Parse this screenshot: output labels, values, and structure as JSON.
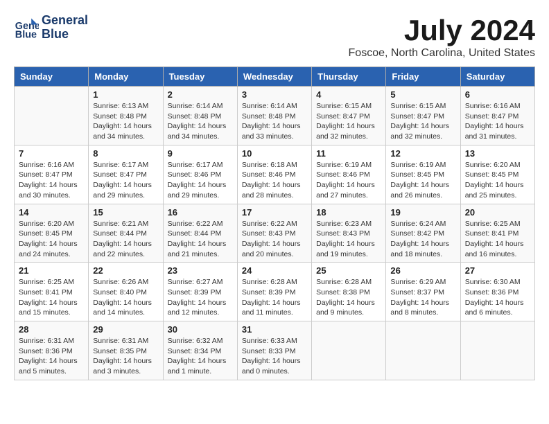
{
  "header": {
    "logo_line1": "General",
    "logo_line2": "Blue",
    "month": "July 2024",
    "location": "Foscoe, North Carolina, United States"
  },
  "days_of_week": [
    "Sunday",
    "Monday",
    "Tuesday",
    "Wednesday",
    "Thursday",
    "Friday",
    "Saturday"
  ],
  "weeks": [
    [
      {
        "num": "",
        "rise": "",
        "set": "",
        "daylight": ""
      },
      {
        "num": "1",
        "rise": "6:13 AM",
        "set": "8:48 PM",
        "daylight": "14 hours and 34 minutes."
      },
      {
        "num": "2",
        "rise": "6:14 AM",
        "set": "8:48 PM",
        "daylight": "14 hours and 34 minutes."
      },
      {
        "num": "3",
        "rise": "6:14 AM",
        "set": "8:48 PM",
        "daylight": "14 hours and 33 minutes."
      },
      {
        "num": "4",
        "rise": "6:15 AM",
        "set": "8:47 PM",
        "daylight": "14 hours and 32 minutes."
      },
      {
        "num": "5",
        "rise": "6:15 AM",
        "set": "8:47 PM",
        "daylight": "14 hours and 32 minutes."
      },
      {
        "num": "6",
        "rise": "6:16 AM",
        "set": "8:47 PM",
        "daylight": "14 hours and 31 minutes."
      }
    ],
    [
      {
        "num": "7",
        "rise": "6:16 AM",
        "set": "8:47 PM",
        "daylight": "14 hours and 30 minutes."
      },
      {
        "num": "8",
        "rise": "6:17 AM",
        "set": "8:47 PM",
        "daylight": "14 hours and 29 minutes."
      },
      {
        "num": "9",
        "rise": "6:17 AM",
        "set": "8:46 PM",
        "daylight": "14 hours and 29 minutes."
      },
      {
        "num": "10",
        "rise": "6:18 AM",
        "set": "8:46 PM",
        "daylight": "14 hours and 28 minutes."
      },
      {
        "num": "11",
        "rise": "6:19 AM",
        "set": "8:46 PM",
        "daylight": "14 hours and 27 minutes."
      },
      {
        "num": "12",
        "rise": "6:19 AM",
        "set": "8:45 PM",
        "daylight": "14 hours and 26 minutes."
      },
      {
        "num": "13",
        "rise": "6:20 AM",
        "set": "8:45 PM",
        "daylight": "14 hours and 25 minutes."
      }
    ],
    [
      {
        "num": "14",
        "rise": "6:20 AM",
        "set": "8:45 PM",
        "daylight": "14 hours and 24 minutes."
      },
      {
        "num": "15",
        "rise": "6:21 AM",
        "set": "8:44 PM",
        "daylight": "14 hours and 22 minutes."
      },
      {
        "num": "16",
        "rise": "6:22 AM",
        "set": "8:44 PM",
        "daylight": "14 hours and 21 minutes."
      },
      {
        "num": "17",
        "rise": "6:22 AM",
        "set": "8:43 PM",
        "daylight": "14 hours and 20 minutes."
      },
      {
        "num": "18",
        "rise": "6:23 AM",
        "set": "8:43 PM",
        "daylight": "14 hours and 19 minutes."
      },
      {
        "num": "19",
        "rise": "6:24 AM",
        "set": "8:42 PM",
        "daylight": "14 hours and 18 minutes."
      },
      {
        "num": "20",
        "rise": "6:25 AM",
        "set": "8:41 PM",
        "daylight": "14 hours and 16 minutes."
      }
    ],
    [
      {
        "num": "21",
        "rise": "6:25 AM",
        "set": "8:41 PM",
        "daylight": "14 hours and 15 minutes."
      },
      {
        "num": "22",
        "rise": "6:26 AM",
        "set": "8:40 PM",
        "daylight": "14 hours and 14 minutes."
      },
      {
        "num": "23",
        "rise": "6:27 AM",
        "set": "8:39 PM",
        "daylight": "14 hours and 12 minutes."
      },
      {
        "num": "24",
        "rise": "6:28 AM",
        "set": "8:39 PM",
        "daylight": "14 hours and 11 minutes."
      },
      {
        "num": "25",
        "rise": "6:28 AM",
        "set": "8:38 PM",
        "daylight": "14 hours and 9 minutes."
      },
      {
        "num": "26",
        "rise": "6:29 AM",
        "set": "8:37 PM",
        "daylight": "14 hours and 8 minutes."
      },
      {
        "num": "27",
        "rise": "6:30 AM",
        "set": "8:36 PM",
        "daylight": "14 hours and 6 minutes."
      }
    ],
    [
      {
        "num": "28",
        "rise": "6:31 AM",
        "set": "8:36 PM",
        "daylight": "14 hours and 5 minutes."
      },
      {
        "num": "29",
        "rise": "6:31 AM",
        "set": "8:35 PM",
        "daylight": "14 hours and 3 minutes."
      },
      {
        "num": "30",
        "rise": "6:32 AM",
        "set": "8:34 PM",
        "daylight": "14 hours and 1 minute."
      },
      {
        "num": "31",
        "rise": "6:33 AM",
        "set": "8:33 PM",
        "daylight": "14 hours and 0 minutes."
      },
      {
        "num": "",
        "rise": "",
        "set": "",
        "daylight": ""
      },
      {
        "num": "",
        "rise": "",
        "set": "",
        "daylight": ""
      },
      {
        "num": "",
        "rise": "",
        "set": "",
        "daylight": ""
      }
    ]
  ],
  "labels": {
    "sunrise": "Sunrise:",
    "sunset": "Sunset:",
    "daylight": "Daylight:"
  }
}
